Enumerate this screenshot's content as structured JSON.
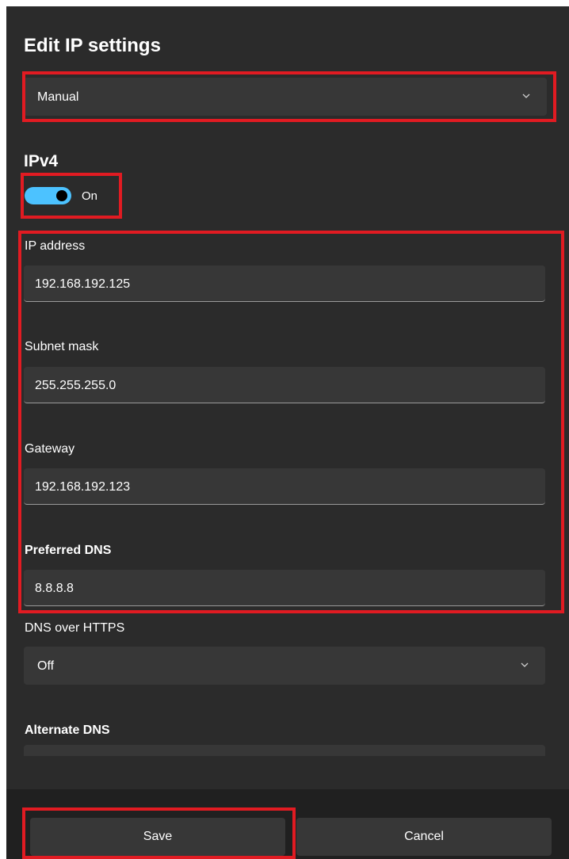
{
  "dialog": {
    "title": "Edit IP settings",
    "mode_select": {
      "value": "Manual",
      "icon": "chevron-down-icon"
    }
  },
  "ipv4": {
    "heading": "IPv4",
    "toggle": {
      "state_label": "On",
      "on": true,
      "accent_color": "#4cc2ff"
    },
    "fields": {
      "ip_address": {
        "label": "IP address",
        "value": "192.168.192.125"
      },
      "subnet_mask": {
        "label": "Subnet mask",
        "value": "255.255.255.0"
      },
      "gateway": {
        "label": "Gateway",
        "value": "192.168.192.123"
      },
      "preferred_dns": {
        "label": "Preferred DNS",
        "value": "8.8.8.8"
      }
    },
    "dns_over_https": {
      "label": "DNS over HTTPS",
      "value": "Off",
      "icon": "chevron-down-icon"
    },
    "alternate_dns": {
      "label": "Alternate DNS",
      "value": ""
    }
  },
  "footer": {
    "save_label": "Save",
    "cancel_label": "Cancel"
  },
  "colors": {
    "background": "#2b2b2b",
    "control": "#373737",
    "footer": "#202020",
    "highlight": "#e11b22"
  }
}
